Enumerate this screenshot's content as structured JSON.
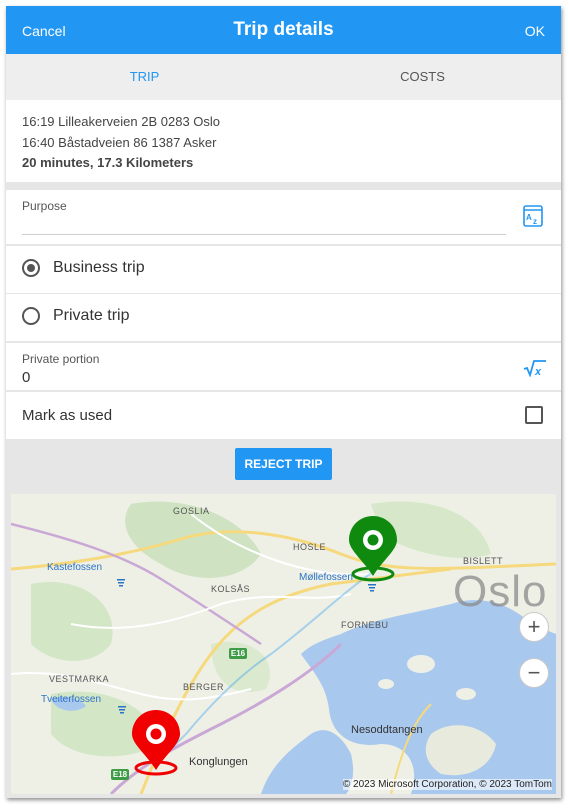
{
  "header": {
    "cancel_label": "Cancel",
    "title": "Trip details",
    "ok_label": "OK"
  },
  "tabs": [
    {
      "label": "TRIP",
      "active": true
    },
    {
      "label": "COSTS",
      "active": false
    }
  ],
  "summary": {
    "start": "16:19 Lilleakerveien 2B 0283 Oslo",
    "end": "16:40 Båstadveien 86 1387 Asker",
    "duration_distance": "20 minutes, 17.3 Kilometers"
  },
  "purpose": {
    "label": "Purpose",
    "value": "",
    "icon": "az-sort-icon"
  },
  "trip_type": {
    "options": [
      {
        "label": "Business trip",
        "selected": true
      },
      {
        "label": "Private trip",
        "selected": false
      }
    ]
  },
  "private_portion": {
    "label": "Private portion",
    "value": "0",
    "icon": "sqrt-x-icon"
  },
  "mark_as_used": {
    "label": "Mark as used",
    "checked": false
  },
  "reject_button": {
    "label": "REJECT TRIP"
  },
  "map": {
    "labels": {
      "goslia": "GOSLIA",
      "kastefossen": "Kastefossen",
      "kolsas": "KOLSÅS",
      "hosle": "HOSLE",
      "mollefossen": "Møllefossen",
      "bislett": "BISLETT",
      "fornebu": "FORNEBU",
      "oslo": "Oslo",
      "vestmarka": "VESTMARKA",
      "tveiterfossen": "Tveiterfossen",
      "berger": "BERGER",
      "konglungen": "Konglungen",
      "nesoddtangen": "Nesoddtangen"
    },
    "shields": {
      "e16": "E16",
      "e18": "E18"
    },
    "zoom_in": "+",
    "zoom_out": "−",
    "copyright": "© 2023 Microsoft Corporation, © 2023 TomTom",
    "colors": {
      "water": "#a9c8ee",
      "start_pin": "#0f8a0f",
      "end_pin": "#f00000",
      "accent": "#2196f3"
    }
  }
}
